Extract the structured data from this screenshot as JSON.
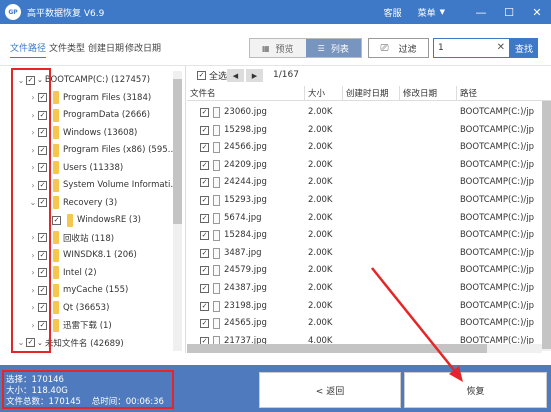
{
  "app": {
    "title": "高平数据恢复",
    "version": "V6.9",
    "logo_text": "GP"
  },
  "titlebar": {
    "service": "客服",
    "menu": "菜单"
  },
  "sort_tabs": [
    "文件路径",
    "文件类型",
    "创建日期",
    "修改日期"
  ],
  "view": {
    "preview": "预览",
    "list": "列表"
  },
  "filter_label": "过滤",
  "search": {
    "value": "1",
    "button": "查找"
  },
  "tree": [
    {
      "label": "BOOTCAMP(C:)  (127457)",
      "level": 0,
      "expanded": true
    },
    {
      "label": "Program Files  (3184)",
      "level": 1
    },
    {
      "label": "ProgramData  (2666)",
      "level": 1
    },
    {
      "label": "Windows  (13608)",
      "level": 1
    },
    {
      "label": "Program Files (x86)  (595…",
      "level": 1
    },
    {
      "label": "Users  (11338)",
      "level": 1
    },
    {
      "label": "System Volume Informati…",
      "level": 1
    },
    {
      "label": "Recovery  (3)",
      "level": 1,
      "expanded": true
    },
    {
      "label": "WindowsRE  (3)",
      "level": 2
    },
    {
      "label": "回收站  (118)",
      "level": 1
    },
    {
      "label": "WINSDK8.1  (206)",
      "level": 1
    },
    {
      "label": "Intel  (2)",
      "level": 1
    },
    {
      "label": "myCache  (155)",
      "level": 1
    },
    {
      "label": "Qt  (36653)",
      "level": 1
    },
    {
      "label": "迅雷下载  (1)",
      "level": 1
    },
    {
      "label": "未知文件名  (42689)",
      "level": 0,
      "expanded": true
    }
  ],
  "filelist": {
    "select_all": "全选",
    "page_info": "1/167",
    "columns": [
      "文件名",
      "大小",
      "创建时日期",
      "修改日期",
      "路径"
    ],
    "rows": [
      {
        "name": "23060.jpg",
        "size": "2.00K",
        "path": "BOOTCAMP(C:)/jp"
      },
      {
        "name": "15298.jpg",
        "size": "2.00K",
        "path": "BOOTCAMP(C:)/jp"
      },
      {
        "name": "24566.jpg",
        "size": "2.00K",
        "path": "BOOTCAMP(C:)/jp"
      },
      {
        "name": "24209.jpg",
        "size": "2.00K",
        "path": "BOOTCAMP(C:)/jp"
      },
      {
        "name": "24244.jpg",
        "size": "2.00K",
        "path": "BOOTCAMP(C:)/jp"
      },
      {
        "name": "15293.jpg",
        "size": "2.00K",
        "path": "BOOTCAMP(C:)/jp"
      },
      {
        "name": "5674.jpg",
        "size": "2.00K",
        "path": "BOOTCAMP(C:)/jp"
      },
      {
        "name": "15284.jpg",
        "size": "2.00K",
        "path": "BOOTCAMP(C:)/jp"
      },
      {
        "name": "3487.jpg",
        "size": "2.00K",
        "path": "BOOTCAMP(C:)/jp"
      },
      {
        "name": "24579.jpg",
        "size": "2.00K",
        "path": "BOOTCAMP(C:)/jp"
      },
      {
        "name": "24387.jpg",
        "size": "2.00K",
        "path": "BOOTCAMP(C:)/jp"
      },
      {
        "name": "23198.jpg",
        "size": "2.00K",
        "path": "BOOTCAMP(C:)/jp"
      },
      {
        "name": "24565.jpg",
        "size": "2.00K",
        "path": "BOOTCAMP(C:)/jp"
      },
      {
        "name": "21737.jpg",
        "size": "4.00K",
        "path": "BOOTCAMP(C:)/jp"
      }
    ]
  },
  "stats": {
    "selected": "选择：170146",
    "size": "大小：118.40G",
    "total": "文件总数：170145",
    "time": "总时间：00:06:36"
  },
  "buttons": {
    "back": "< 返回",
    "recover": "恢复"
  },
  "colors": {
    "accent": "#3e79c7",
    "bottom_bar": "#4f7abd",
    "highlight": "#e32727"
  }
}
